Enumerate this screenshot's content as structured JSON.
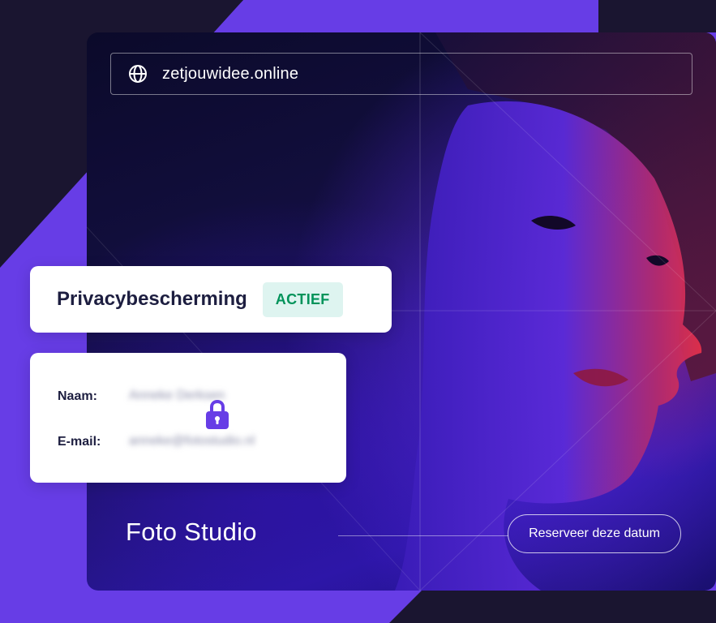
{
  "browser": {
    "url": "zetjouwidee.online",
    "icon": "globe-icon"
  },
  "site": {
    "brand": "Foto Studio",
    "cta_label": "Reserveer deze datum"
  },
  "privacy": {
    "title": "Privacybescherming",
    "status": "ACTIEF",
    "status_color": "#00935a",
    "status_bg": "#def4f0"
  },
  "contact": {
    "name_label": "Naam:",
    "name_value": "Anneke Derksen",
    "email_label": "E-mail:",
    "email_value": "anneke@fotostudio.nl",
    "lock_icon": "lock-icon"
  },
  "colors": {
    "accent": "#673de6",
    "dark": "#1a1530",
    "text_dark": "#1d1e40"
  }
}
